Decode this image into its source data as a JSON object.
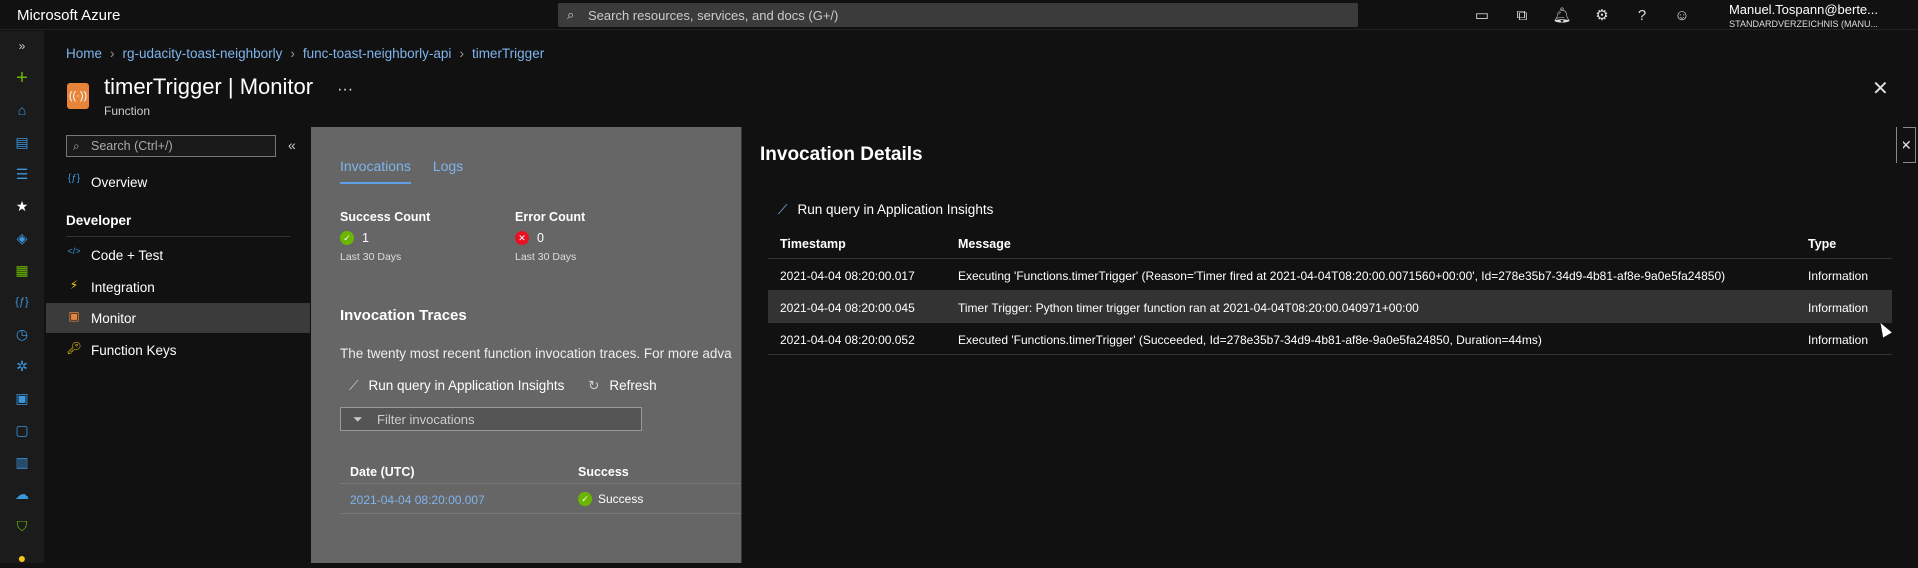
{
  "topbar": {
    "brand": "Microsoft Azure",
    "search_placeholder": "Search resources, services, and docs (G+/)",
    "icons": [
      "cloud-shell-icon",
      "directory-filter-icon",
      "bell-icon",
      "gear-icon",
      "help-icon",
      "feedback-icon"
    ],
    "account_name": "Manuel.Tospann@berte...",
    "account_directory": "STANDARDVERZEICHNIS (MANU..."
  },
  "breadcrumb": [
    "Home",
    "rg-udacity-toast-neighborly",
    "func-toast-neighborly-api",
    "timerTrigger"
  ],
  "header": {
    "title": "timerTrigger | Monitor",
    "subtitle": "Function",
    "more": "···",
    "close": "✕"
  },
  "sidebar": {
    "search_placeholder": "Search (Ctrl+/)",
    "collapse": "«",
    "overview": "Overview",
    "section_developer": "Developer",
    "items": [
      {
        "label": "Code + Test",
        "icon": "code-icon"
      },
      {
        "label": "Integration",
        "icon": "lightning-icon"
      },
      {
        "label": "Monitor",
        "icon": "monitor-icon"
      },
      {
        "label": "Function Keys",
        "icon": "key-icon"
      }
    ]
  },
  "monitor": {
    "tabs": [
      "Invocations",
      "Logs"
    ],
    "success": {
      "label": "Success Count",
      "value": "1",
      "period": "Last 30 Days"
    },
    "error": {
      "label": "Error Count",
      "value": "0",
      "period": "Last 30 Days"
    },
    "traces_heading": "Invocation Traces",
    "traces_desc": "The twenty most recent function invocation traces. For more adva",
    "run_query": "Run query in Application Insights",
    "refresh": "Refresh",
    "filter_placeholder": "Filter invocations",
    "columns": [
      "Date (UTC)",
      "Success"
    ],
    "rows": [
      {
        "date": "2021-04-04 08:20:00.007",
        "status": "Success"
      }
    ]
  },
  "details": {
    "title": "Invocation Details",
    "close": "✕",
    "run_query": "Run query in Application Insights",
    "columns": [
      "Timestamp",
      "Message",
      "Type"
    ],
    "rows": [
      {
        "ts": "2021-04-04 08:20:00.017",
        "msg": "Executing 'Functions.timerTrigger' (Reason='Timer fired at 2021-04-04T08:20:00.0071560+00:00', Id=278e35b7-34d9-4b81-af8e-9a0e5fa24850)",
        "type": "Information"
      },
      {
        "ts": "2021-04-04 08:20:00.045",
        "msg": "Timer Trigger: Python timer trigger function ran at 2021-04-04T08:20:00.040971+00:00",
        "type": "Information"
      },
      {
        "ts": "2021-04-04 08:20:00.052",
        "msg": "Executed 'Functions.timerTrigger' (Succeeded, Id=278e35b7-34d9-4b81-af8e-9a0e5fa24850, Duration=44ms)",
        "type": "Information"
      }
    ]
  },
  "colors": {
    "accent": "#5ea0e8",
    "success": "#6bb700",
    "error": "#e81123",
    "function_icon": "#e8833a"
  }
}
